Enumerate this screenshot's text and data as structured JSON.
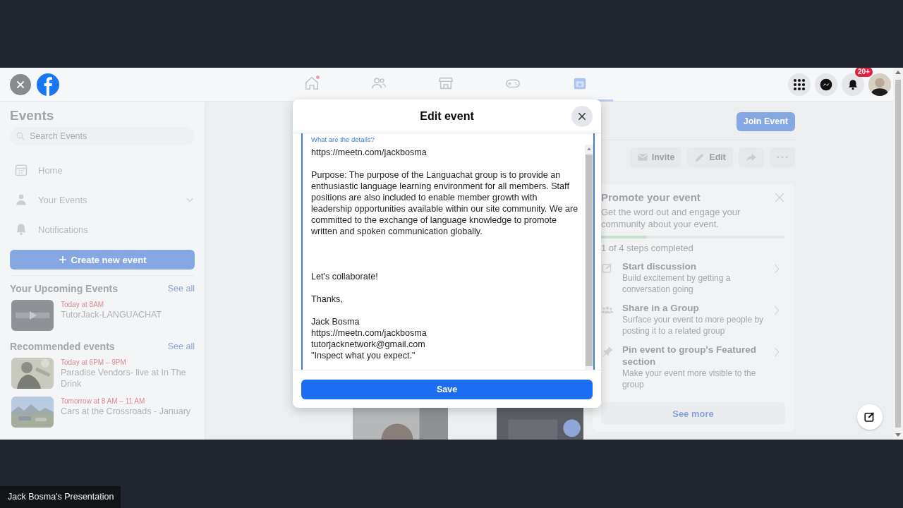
{
  "nav_tabs": [
    {
      "kind": "home",
      "selected": false,
      "notification": true
    },
    {
      "kind": "friends",
      "selected": false,
      "notification": false
    },
    {
      "kind": "marketplace",
      "selected": false,
      "notification": false
    },
    {
      "kind": "gaming",
      "selected": false,
      "notification": false
    },
    {
      "kind": "events",
      "selected": true,
      "notification": false
    }
  ],
  "notifications_badge": "20+",
  "sidebar": {
    "title": "Events",
    "search": {
      "placeholder": "Search Events"
    },
    "items": [
      {
        "kind": "calendar",
        "label": "Home",
        "expandable": false
      },
      {
        "kind": "person",
        "label": "Your Events",
        "expandable": true
      },
      {
        "kind": "bell",
        "label": "Notifications",
        "expandable": false
      }
    ],
    "create_button": "Create new event",
    "sections": [
      {
        "title": "Your Upcoming Events",
        "see_all": "See all",
        "events": [
          {
            "time": "Today at 8AM",
            "title": "TutorJack-LANGUACHAT"
          }
        ]
      },
      {
        "title": "Recommended events",
        "see_all": "See all",
        "events": [
          {
            "time": "Today at 6PM – 9PM",
            "title": "Paradise Vendors- live at In The Drink"
          },
          {
            "time": "Tomorrow at 8 AM – 11 AM",
            "title": "Cars at the Crossroads - January"
          }
        ]
      }
    ]
  },
  "event_actions": {
    "join": "Join Event",
    "buttons": [
      {
        "kind": "invite",
        "label": "Invite"
      },
      {
        "kind": "edit",
        "label": "Edit"
      },
      {
        "kind": "share"
      },
      {
        "kind": "more"
      }
    ]
  },
  "promote": {
    "title": "Promote your event",
    "description": "Get the word out and engage your community about your event.",
    "progress": {
      "level": 0.25
    },
    "steps_text": "1 of 4 steps completed",
    "steps": [
      {
        "kind": "discussion",
        "title": "Start discussion",
        "description": "Build excitement by getting a conversation going"
      },
      {
        "kind": "group",
        "title": "Share in a Group",
        "description": "Surface your event to more people by posting it to a related group"
      },
      {
        "kind": "pin",
        "title": "Pin event to group's Featured section",
        "description": "Make your event more visible to the group"
      }
    ],
    "see_more": "See more"
  },
  "modal": {
    "title": "Edit event",
    "field": {
      "label": "What are the details?",
      "paragraphs": [
        [
          "https://meetn.com/jackbosma"
        ],
        [
          "Purpose: The purpose of the Languachat group is to provide an enthusiastic language learning environment for all members. Staff positions are also included to enable member growth with leadership opportunities available within our site community. We are committed to the exchange of language knowledge to promote written and spoken communication globally."
        ],
        [
          "Let's collaborate!"
        ],
        [
          "Thanks,"
        ],
        [
          "Jack Bosma",
          "https://meetn.com/jackbosma",
          "tutorjacknetwork@gmail.com",
          "\"Inspect what you expect.\""
        ]
      ]
    },
    "save": "Save"
  },
  "presentation_label": "Jack Bosma's Presentation"
}
